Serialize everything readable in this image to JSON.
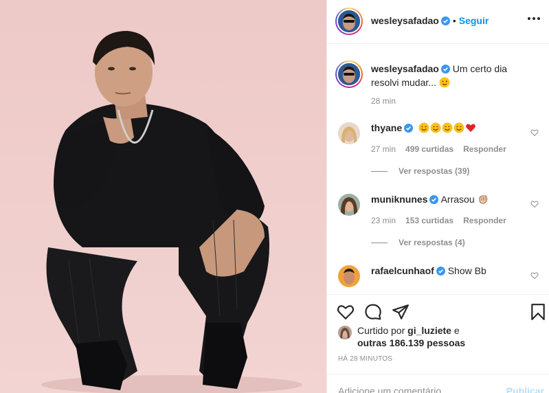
{
  "post": {
    "author": "wesleysafadao",
    "follow_label": "Seguir",
    "dot": "•",
    "caption_text": "Um certo dia resolvi mudar...",
    "caption_time": "28 min"
  },
  "comments": [
    {
      "username": "thyane",
      "text": "",
      "emojis": [
        "smile-emoji",
        "smile-emoji",
        "smile-emoji",
        "smile-emoji",
        "red-heart-emoji"
      ],
      "time": "27 min",
      "likes": "499 curtidas",
      "reply": "Responder",
      "view_replies": "Ver respostas (39)"
    },
    {
      "username": "muniknunes",
      "text": "Arrasou",
      "emojis": [
        "clapping-hands-emoji"
      ],
      "time": "23 min",
      "likes": "153 curtidas",
      "reply": "Responder",
      "view_replies": "Ver respostas (4)"
    },
    {
      "username": "rafaelcunhaof",
      "text": "Show Bb",
      "emojis": [],
      "time": "",
      "likes": "",
      "reply": "",
      "view_replies": ""
    }
  ],
  "likes": {
    "prefix": "Curtido por",
    "user": "gi_luziete",
    "conj": "e",
    "others": "outras 186.139 pessoas"
  },
  "timestamp": "HÁ 28 MINUTOS",
  "comment_box": {
    "placeholder": "Adicione um comentário...",
    "post_label": "Publicar"
  },
  "colors": {
    "accent": "#0095f6",
    "verified": "#3897f0",
    "heart": "#ed4956",
    "photo_bg": "#efcccb"
  }
}
